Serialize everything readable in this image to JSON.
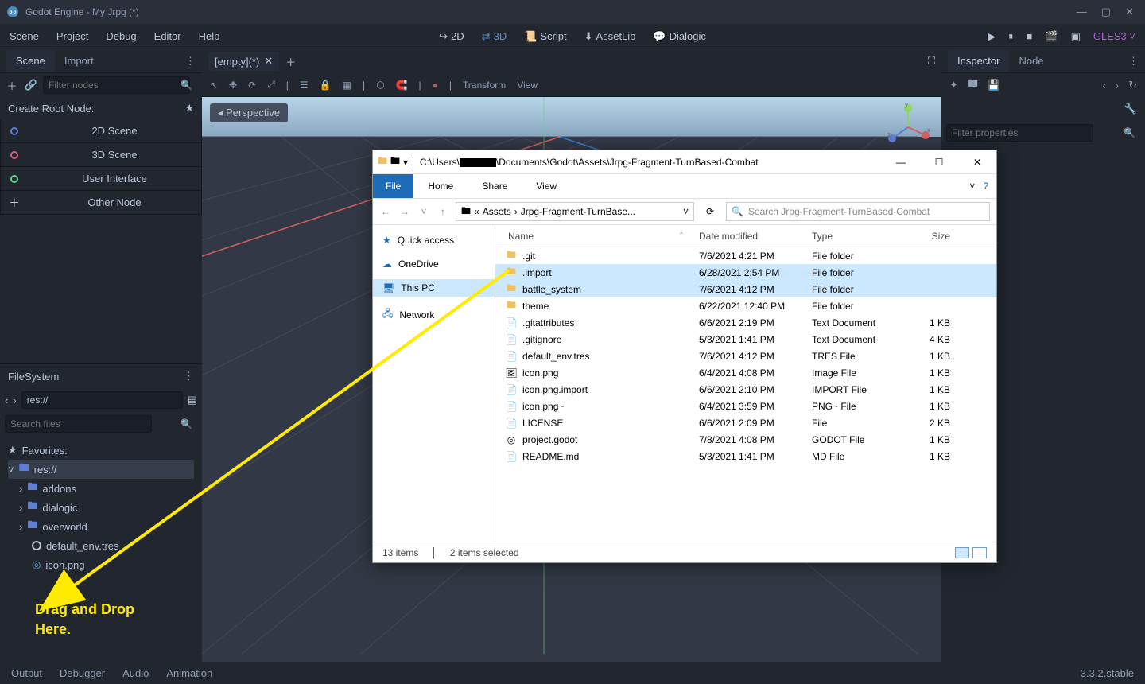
{
  "window": {
    "title": "Godot Engine - My Jrpg (*)"
  },
  "menu": {
    "items": [
      "Scene",
      "Project",
      "Debug",
      "Editor",
      "Help"
    ]
  },
  "modes": {
    "m2d": "2D",
    "m3d": "3D",
    "script": "Script",
    "assetlib": "AssetLib",
    "dialogic": "Dialogic"
  },
  "renderer": "GLES3",
  "scene_panel": {
    "tab_scene": "Scene",
    "tab_import": "Import",
    "filter_placeholder": "Filter nodes",
    "create_root": "Create Root Node:",
    "nodes": {
      "n2d": "2D Scene",
      "n3d": "3D Scene",
      "ui": "User Interface",
      "other": "Other Node"
    }
  },
  "fs_panel": {
    "title": "FileSystem",
    "path": "res://",
    "search_placeholder": "Search files",
    "favorites": "Favorites:",
    "root": "res://",
    "items": [
      "addons",
      "dialogic",
      "overworld",
      "default_env.tres",
      "icon.png"
    ]
  },
  "center": {
    "tab_label": "[empty](*)",
    "perspective": "Perspective",
    "transform": "Transform",
    "view": "View"
  },
  "inspector": {
    "tab_inspector": "Inspector",
    "tab_node": "Node",
    "filter_placeholder": "Filter properties"
  },
  "bottom": {
    "items": [
      "Output",
      "Debugger",
      "Audio",
      "Animation"
    ],
    "version": "3.3.2.stable"
  },
  "explorer": {
    "path_prefix": "C:\\Users\\",
    "path_suffix": "\\Documents\\Godot\\Assets\\Jrpg-Fragment-TurnBased-Combat",
    "ribbon": {
      "file": "File",
      "home": "Home",
      "share": "Share",
      "view": "View"
    },
    "crumbs": {
      "pre": "«",
      "assets": "Assets",
      "sep": "›",
      "leaf": "Jrpg-Fragment-TurnBase..."
    },
    "search_placeholder": "Search Jrpg-Fragment-TurnBased-Combat",
    "side": {
      "quick": "Quick access",
      "onedrive": "OneDrive",
      "thispc": "This PC",
      "network": "Network"
    },
    "cols": {
      "name": "Name",
      "date": "Date modified",
      "type": "Type",
      "size": "Size"
    },
    "rows": [
      {
        "name": ".git",
        "date": "7/6/2021 4:21 PM",
        "type": "File folder",
        "size": "",
        "kind": "folder",
        "sel": false
      },
      {
        "name": ".import",
        "date": "6/28/2021 2:54 PM",
        "type": "File folder",
        "size": "",
        "kind": "folder",
        "sel": true
      },
      {
        "name": "battle_system",
        "date": "7/6/2021 4:12 PM",
        "type": "File folder",
        "size": "",
        "kind": "folder",
        "sel": true
      },
      {
        "name": "theme",
        "date": "6/22/2021 12:40 PM",
        "type": "File folder",
        "size": "",
        "kind": "folder",
        "sel": false
      },
      {
        "name": ".gitattributes",
        "date": "6/6/2021 2:19 PM",
        "type": "Text Document",
        "size": "1 KB",
        "kind": "file",
        "sel": false
      },
      {
        "name": ".gitignore",
        "date": "5/3/2021 1:41 PM",
        "type": "Text Document",
        "size": "4 KB",
        "kind": "file",
        "sel": false
      },
      {
        "name": "default_env.tres",
        "date": "7/6/2021 4:12 PM",
        "type": "TRES File",
        "size": "1 KB",
        "kind": "file",
        "sel": false
      },
      {
        "name": "icon.png",
        "date": "6/4/2021 4:08 PM",
        "type": "Image File",
        "size": "1 KB",
        "kind": "img",
        "sel": false
      },
      {
        "name": "icon.png.import",
        "date": "6/6/2021 2:10 PM",
        "type": "IMPORT File",
        "size": "1 KB",
        "kind": "file",
        "sel": false
      },
      {
        "name": "icon.png~",
        "date": "6/4/2021 3:59 PM",
        "type": "PNG~ File",
        "size": "1 KB",
        "kind": "file",
        "sel": false
      },
      {
        "name": "LICENSE",
        "date": "6/6/2021 2:09 PM",
        "type": "File",
        "size": "2 KB",
        "kind": "file",
        "sel": false
      },
      {
        "name": "project.godot",
        "date": "7/8/2021 4:08 PM",
        "type": "GODOT File",
        "size": "1 KB",
        "kind": "godot",
        "sel": false
      },
      {
        "name": "README.md",
        "date": "5/3/2021 1:41 PM",
        "type": "MD File",
        "size": "1 KB",
        "kind": "file",
        "sel": false
      }
    ],
    "status": {
      "count": "13 items",
      "selected": "2 items selected"
    }
  },
  "annotation": {
    "line1": "Drag and Drop",
    "line2": "Here."
  },
  "chart_data": null
}
